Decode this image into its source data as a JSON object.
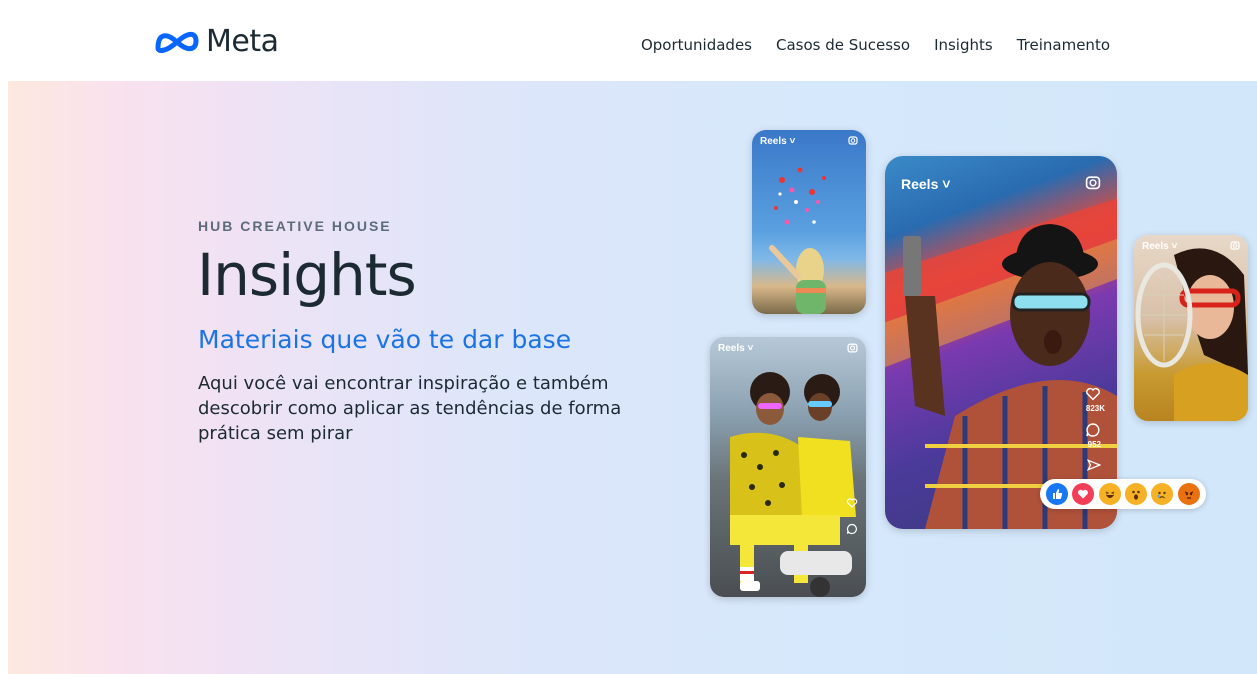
{
  "header": {
    "logo_text": "Meta",
    "nav": [
      "Oportunidades",
      "Casos de Sucesso",
      "Insights",
      "Treinamento"
    ]
  },
  "hero": {
    "eyebrow": "HUB CREATIVE HOUSE",
    "title": "Insights",
    "subtitle": "Materiais que vão te dar base",
    "description": "Aqui você vai encontrar inspiração e também descobrir como aplicar as tendências de forma prática sem pirar"
  },
  "phones": {
    "reels_label": "Reels ˅",
    "likes": "823K",
    "comments": "952"
  },
  "colors": {
    "brand_blue": "#1b74e4",
    "text_dark": "#1c2b33"
  },
  "icons": [
    "meta-logo-icon",
    "camera-icon",
    "heart-icon",
    "comment-icon",
    "share-icon",
    "like-reaction-icon",
    "love-reaction-icon",
    "haha-reaction-icon",
    "wow-reaction-icon",
    "sad-reaction-icon",
    "angry-reaction-icon"
  ]
}
